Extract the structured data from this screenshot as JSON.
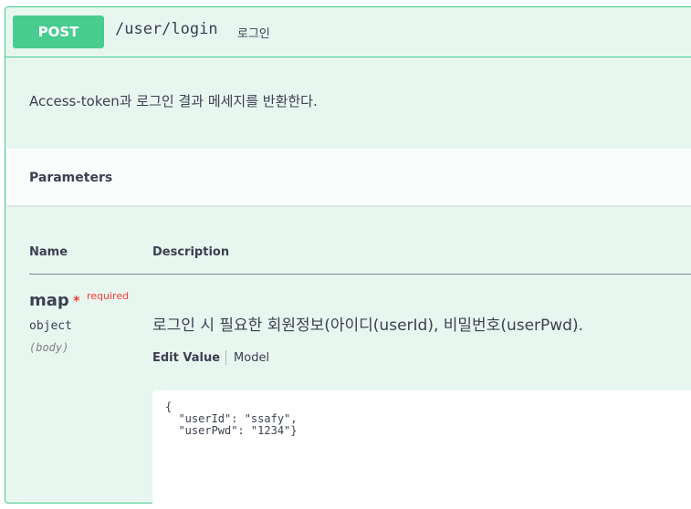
{
  "operation": {
    "method": "POST",
    "path": "/user/login",
    "summary": "로그인",
    "description": "Access-token과 로그인 결과 메세지를 반환한다."
  },
  "parameters": {
    "title": "Parameters",
    "columns": {
      "name": "Name",
      "description": "Description"
    },
    "items": [
      {
        "name": "map",
        "required_mark": "*",
        "required_label": "required",
        "type": "object",
        "in": "(body)",
        "description": "로그인 시 필요한 회원정보(아이디(userId), 비밀번호(userPwd).",
        "tabs": {
          "edit_value": "Edit Value",
          "model": "Model"
        },
        "example_lines": [
          "{",
          "  \"userId\": \"ssafy\",",
          "  \"userPwd\": \"1234\"}"
        ]
      }
    ]
  },
  "colors": {
    "post_accent": "#49cc90",
    "post_background": "#e8f6f0",
    "required": "#ff0000"
  }
}
